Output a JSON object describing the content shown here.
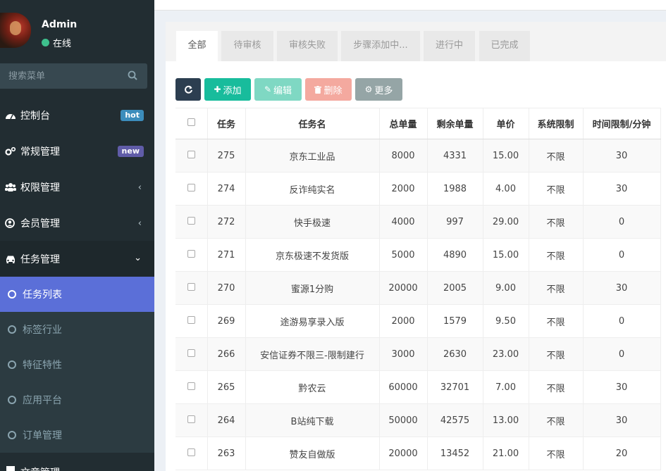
{
  "user": {
    "name": "Admin",
    "status": "在线"
  },
  "search": {
    "placeholder": "搜索菜单"
  },
  "menu": {
    "dashboard": {
      "label": "控制台",
      "badge": "hot"
    },
    "general": {
      "label": "常规管理",
      "badge": "new"
    },
    "auth": {
      "label": "权限管理"
    },
    "member": {
      "label": "会员管理"
    },
    "task": {
      "label": "任务管理"
    },
    "sub": [
      "任务列表",
      "标签行业",
      "特征特性",
      "应用平台",
      "订单管理"
    ],
    "cut_label": "文章管理"
  },
  "tabs": [
    "全部",
    "待审核",
    "审核失败",
    "步骤添加中...",
    "进行中",
    "已完成"
  ],
  "toolbar": {
    "add": "添加",
    "edit": "编辑",
    "delete": "删除",
    "more": "更多"
  },
  "table": {
    "headers": [
      "任务",
      "任务名",
      "总单量",
      "剩余单量",
      "单价",
      "系统限制",
      "时间限制/分钟"
    ],
    "rows": [
      [
        "275",
        "京东工业品",
        "8000",
        "4331",
        "15.00",
        "不限",
        "30"
      ],
      [
        "274",
        "反诈纯实名",
        "2000",
        "1988",
        "4.00",
        "不限",
        "30"
      ],
      [
        "272",
        "快手极速",
        "4000",
        "997",
        "29.00",
        "不限",
        "0"
      ],
      [
        "271",
        "京东极速不发货版",
        "5000",
        "4890",
        "15.00",
        "不限",
        "0"
      ],
      [
        "270",
        "蜜源1分购",
        "20000",
        "2005",
        "9.00",
        "不限",
        "30"
      ],
      [
        "269",
        "途游易享录入版",
        "2000",
        "1579",
        "9.50",
        "不限",
        "0"
      ],
      [
        "266",
        "安信证券不限三-限制建行",
        "3000",
        "2630",
        "23.00",
        "不限",
        "0"
      ],
      [
        "265",
        "黔农云",
        "60000",
        "32701",
        "7.00",
        "不限",
        "30"
      ],
      [
        "264",
        "B站纯下载",
        "50000",
        "42575",
        "13.00",
        "不限",
        "30"
      ],
      [
        "263",
        "赞友自做版",
        "20000",
        "13452",
        "21.00",
        "不限",
        "20"
      ]
    ]
  }
}
